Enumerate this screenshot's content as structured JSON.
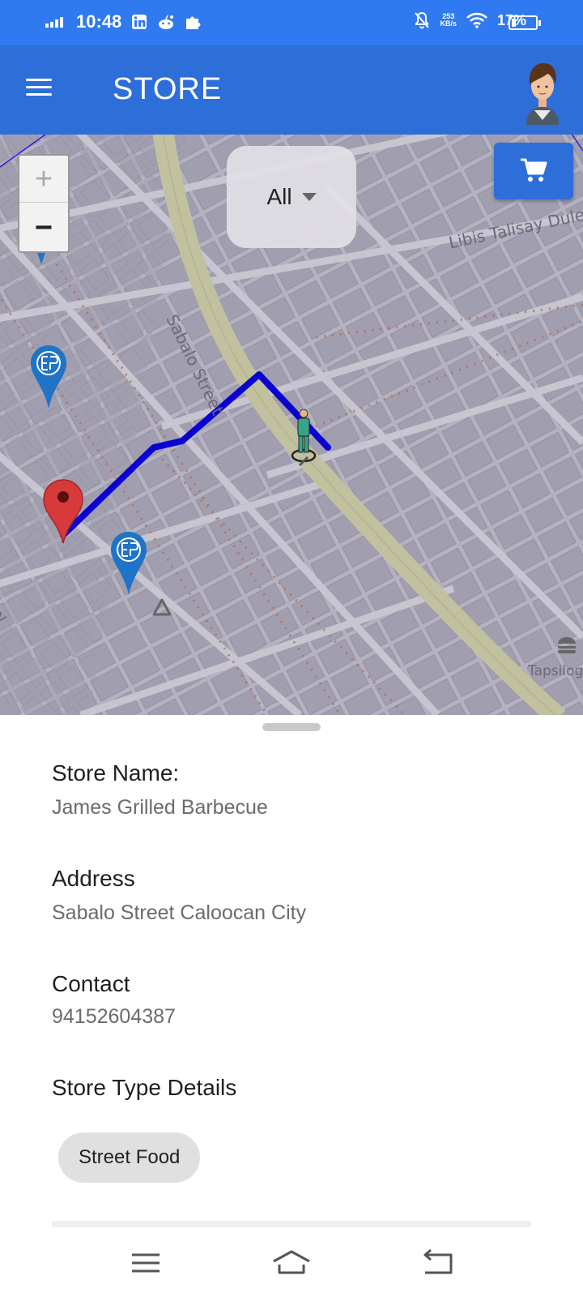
{
  "status_bar": {
    "time": "10:48",
    "net_speed_value": "253",
    "net_speed_unit": "KB/s",
    "battery": "17%",
    "battery_level": 0.17,
    "icons": [
      "signal-icon",
      "linkedin-icon",
      "reddit-icon",
      "puzzle-icon",
      "mute-bell-icon",
      "wifi-icon",
      "battery-icon"
    ]
  },
  "app_bar": {
    "title": "STORE",
    "menu_icon": "hamburger-menu-icon",
    "avatar_icon": "user-avatar"
  },
  "map": {
    "zoom_in_label": "+",
    "zoom_out_label": "−",
    "filter": {
      "selected": "All"
    },
    "cart_icon": "cart-icon",
    "street_labels": [
      "Sabalo Street",
      "Libis Talisay Dule",
      "Tapsilog",
      "ey"
    ],
    "route_color": "#0a00d0",
    "destination_pin_color": "#d63a3a",
    "store_pin_color": "#1f74c8"
  },
  "store": {
    "name_label": "Store Name:",
    "name_value": "James Grilled Barbecue",
    "address_label": "Address",
    "address_value": "Sabalo Street Caloocan City",
    "contact_label": "Contact",
    "contact_value": "94152604387",
    "type_label": "Store Type Details",
    "type_chip": "Street Food"
  },
  "nav_bar": {
    "icons": [
      "recent-apps-icon",
      "home-icon",
      "back-icon"
    ]
  },
  "colors": {
    "status_bar": "#2f7af0",
    "app_bar": "#2e6ed9",
    "map_base": "#b2afbe",
    "main_road": "#bfbf9f"
  }
}
